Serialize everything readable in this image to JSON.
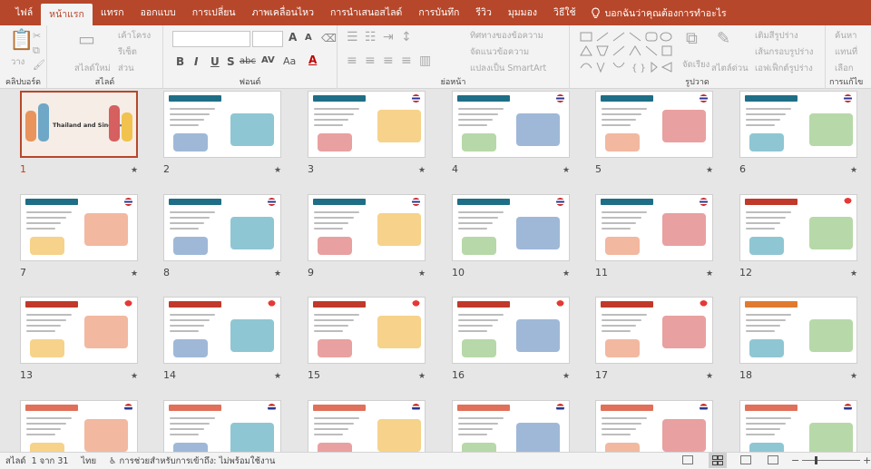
{
  "tabs": [
    {
      "label": "ไฟล์",
      "active": false
    },
    {
      "label": "หน้าแรก",
      "active": true
    },
    {
      "label": "แทรก",
      "active": false
    },
    {
      "label": "ออกแบบ",
      "active": false
    },
    {
      "label": "การเปลี่ยน",
      "active": false
    },
    {
      "label": "ภาพเคลื่อนไหว",
      "active": false
    },
    {
      "label": "การนำเสนอสไลด์",
      "active": false
    },
    {
      "label": "การบันทึก",
      "active": false
    },
    {
      "label": "รีวิว",
      "active": false
    },
    {
      "label": "มุมมอง",
      "active": false
    },
    {
      "label": "วิธีใช้",
      "active": false
    }
  ],
  "tell_me": "บอกฉันว่าคุณต้องการทำอะไร",
  "ribbon": {
    "clipboard": {
      "label": "คลิปบอร์ด",
      "paste": "วาง"
    },
    "slides": {
      "label": "สไลด์",
      "new_slide": "สไลด์ใหม่",
      "layout": "เค้าโครง",
      "reset": "รีเซ็ต",
      "section": "ส่วน"
    },
    "font": {
      "label": "ฟอนต์",
      "bold": "B",
      "italic": "I",
      "underline": "U",
      "strike": "S",
      "strikethrough": "abc",
      "spacing": "AV",
      "case": "Aa",
      "grow": "A",
      "shrink": "A"
    },
    "paragraph": {
      "label": "ย่อหน้า",
      "text_direction": "ทิศทางของข้อความ",
      "align_text": "จัดแนวข้อความ",
      "convert_smartart": "แปลงเป็น SmartArt"
    },
    "drawing": {
      "label": "รูปวาด",
      "arrange": "จัดเรียง",
      "quick_styles": "สไตล์ด่วน",
      "shape_fill": "เติมสีรูปร่าง",
      "shape_outline": "เส้นกรอบรูปร่าง",
      "shape_effects": "เอฟเฟ็กต์รูปร่าง"
    },
    "editing": {
      "label": "การแก้ไข",
      "find": "ค้นหา",
      "replace": "แทนที่",
      "select": "เลือก"
    }
  },
  "slides": [
    {
      "number": "1",
      "selected": true,
      "title": "Thailand and Singapore",
      "color": "#c4584a",
      "flag": "th"
    },
    {
      "number": "2",
      "selected": false,
      "color": "#1e6f86",
      "flag": "none"
    },
    {
      "number": "3",
      "selected": false,
      "color": "#1e6f86",
      "flag": "th"
    },
    {
      "number": "4",
      "selected": false,
      "color": "#1e6f86",
      "flag": "th"
    },
    {
      "number": "5",
      "selected": false,
      "color": "#1e6f86",
      "flag": "th"
    },
    {
      "number": "6",
      "selected": false,
      "color": "#1e6f86",
      "flag": "th"
    },
    {
      "number": "7",
      "selected": false,
      "color": "#1e6f86",
      "flag": "th"
    },
    {
      "number": "8",
      "selected": false,
      "color": "#1e6f86",
      "flag": "th"
    },
    {
      "number": "9",
      "selected": false,
      "color": "#1e6f86",
      "flag": "th"
    },
    {
      "number": "10",
      "selected": false,
      "color": "#1e6f86",
      "flag": "th"
    },
    {
      "number": "11",
      "selected": false,
      "color": "#1e6f86",
      "flag": "th"
    },
    {
      "number": "12",
      "selected": false,
      "color": "#c0392b",
      "flag": "sg"
    },
    {
      "number": "13",
      "selected": false,
      "color": "#c0392b",
      "flag": "sg"
    },
    {
      "number": "14",
      "selected": false,
      "color": "#c0392b",
      "flag": "sg"
    },
    {
      "number": "15",
      "selected": false,
      "color": "#c0392b",
      "flag": "sg"
    },
    {
      "number": "16",
      "selected": false,
      "color": "#c0392b",
      "flag": "sg"
    },
    {
      "number": "17",
      "selected": false,
      "color": "#c0392b",
      "flag": "sg"
    },
    {
      "number": "18",
      "selected": false,
      "color": "#e07a2e",
      "flag": "none"
    },
    {
      "number": "",
      "selected": false,
      "color": "#e0705a",
      "flag": "both"
    },
    {
      "number": "",
      "selected": false,
      "color": "#e0705a",
      "flag": "both"
    },
    {
      "number": "",
      "selected": false,
      "color": "#e0705a",
      "flag": "both"
    },
    {
      "number": "",
      "selected": false,
      "color": "#e0705a",
      "flag": "both"
    },
    {
      "number": "",
      "selected": false,
      "color": "#e0705a",
      "flag": "both"
    },
    {
      "number": "",
      "selected": false,
      "color": "#e0705a",
      "flag": "both"
    }
  ],
  "status": {
    "slide_label": "สไลด์",
    "slide_count": "1 จาก 31",
    "language": "ไทย",
    "accessibility": "การช่วยสำหรับการเข้าถึง: ไม่พร้อมใช้งาน"
  },
  "colors": {
    "accent": "#b7472a",
    "ribbon_bg": "#f3f3f3",
    "sorter_bg": "#e6e6e6"
  }
}
